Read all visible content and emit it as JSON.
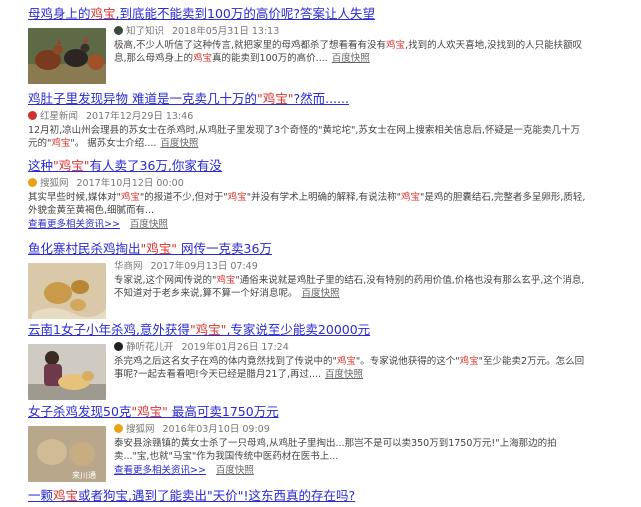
{
  "results": [
    {
      "title": [
        "母鸡身上的",
        "鸡宝",
        ",到底能不能卖到100万的高价呢?答案让人失望"
      ],
      "source": "知了知识",
      "date": "2018年05月31日 13:13",
      "abstract": [
        "极高,不少人听信了这种传言,就把家里的母鸡都杀了想看看有没有",
        "鸡宝",
        ",找到的人欢天喜地,没找到的人只能扶额叹息,那么母鸡身上的",
        "鸡宝",
        "真的能卖到100万的高价...."
      ],
      "cache": "百度快照",
      "icon": "zhiliao-source-icon",
      "color": "#3b4a3b"
    },
    {
      "title": [
        "鸡肚子里发现异物 难道是一克卖几十万的",
        "\"鸡宝\"",
        "?然而......"
      ],
      "source": "红星新闻",
      "date": "2017年12月29日 13:46",
      "abstract": [
        "12月初,凉山州会理县的苏女士在杀鸡时,从鸡肚子里发现了3个奇怪的\"黄坨坨\",苏女士在网上搜索相关信息后,怀疑是一克能卖几十万元的\"",
        "鸡宝",
        "\"。 据苏女士介绍...."
      ],
      "cache": "百度快照",
      "icon": "hongxing-source-icon",
      "color": "#d0312d"
    },
    {
      "title": [
        "这种",
        "\"鸡宝\"",
        "有人卖了36万,你家有没"
      ],
      "source": "搜狐网",
      "date": "2017年10月12日 00:00",
      "abstract": [
        "其实早些时候,媒体对\"",
        "鸡宝",
        "\"的报道不少,但对于\"",
        "鸡宝",
        "\"并没有学术上明确的解释,有说法称\"",
        "鸡宝",
        "\"是鸡的胆囊结石,完整者多呈卵形,质轻,外貌金黄至黄褐色,细腻而有..."
      ],
      "more": "查看更多相关资讯>>",
      "cache": "百度快照",
      "icon": "sohu-source-icon",
      "color": "#e8a317"
    },
    {
      "title": [
        "鱼化寨村民杀鸡掏出",
        "\"鸡宝\"",
        " 网传一克卖36万"
      ],
      "source": "华商网",
      "date": "2017年09月13日 07:49",
      "abstract": [
        "专家说,这个网闻传说的\"",
        "鸡宝",
        "\"通俗来说就是鸡肚子里的结石,没有特别的药用价值,价格也没有那么玄乎,这个消息,不知道对于老乡来说,算不算一个好消息呢。"
      ],
      "cache": "百度快照"
    },
    {
      "title": [
        "云南1女子小年杀鸡,意外获得",
        "\"鸡宝\"",
        ",专家说至少能卖20000元"
      ],
      "source": "静听花儿开",
      "date": "2019年01月26日 17:24",
      "abstract": [
        "杀完鸡之后这名女子在鸡的体内竟然找到了传说中的\"",
        "鸡宝",
        "\"。专家说他获得的这个\"",
        "鸡宝",
        "\"至少能卖2万元。怎么回事呢?一起去看看吧!今天已经是腊月21了,再过...."
      ],
      "cache": "百度快照",
      "icon": "jingting-source-icon",
      "color": "#222222"
    },
    {
      "title": [
        "女子杀鸡发现50克",
        "\"鸡宝\"",
        " 最高可卖1750万元"
      ],
      "source": "搜狐网",
      "date": "2016年03月10日 09:09",
      "abstract": [
        "泰安县涂赣镇的黄女士杀了一只母鸡,从鸡肚子里掏出...那岂不是可以卖350万到1750万元!\"上海那边的拍卖...\"宝,也就\"马宝\"作为我国传统中医药材在医书上..."
      ],
      "more": "查看更多相关资讯>>",
      "cache": "百度快照",
      "icon": "sohu-source-icon",
      "color": "#e8a317"
    },
    {
      "title": [
        "一颗",
        "鸡宝",
        "或者狗宝,遇到了能卖出\"天价\"!这东西真的存在吗?"
      ]
    }
  ],
  "thumb_watermark": "来川通"
}
